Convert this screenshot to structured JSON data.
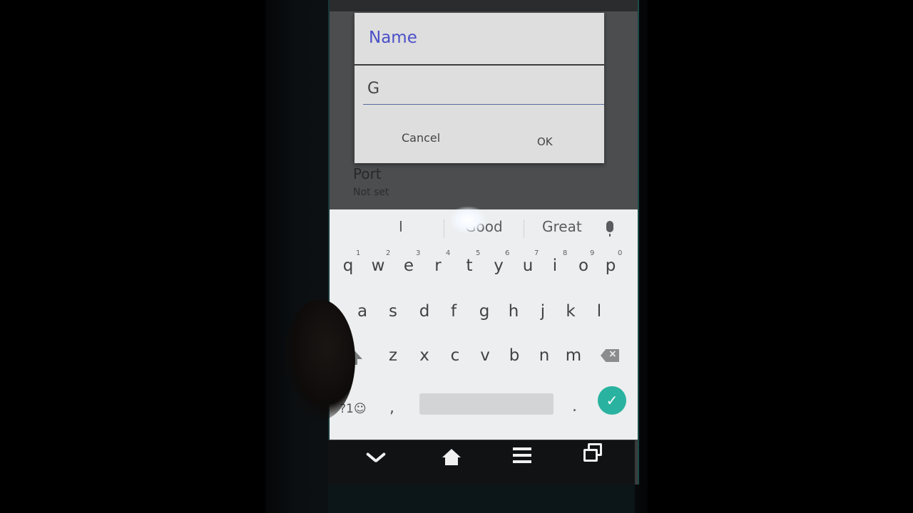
{
  "dialog": {
    "title": "Name",
    "input_value": "G",
    "cancel_label": "Cancel",
    "ok_label": "OK"
  },
  "background_setting": {
    "label": "Port",
    "value": "Not set"
  },
  "keyboard": {
    "suggestions": [
      "I",
      "Good",
      "Great"
    ],
    "row1": [
      {
        "key": "q",
        "num": "1"
      },
      {
        "key": "w",
        "num": "2"
      },
      {
        "key": "e",
        "num": "3"
      },
      {
        "key": "r",
        "num": "4"
      },
      {
        "key": "t",
        "num": "5"
      },
      {
        "key": "y",
        "num": "6"
      },
      {
        "key": "u",
        "num": "7"
      },
      {
        "key": "i",
        "num": "8"
      },
      {
        "key": "o",
        "num": "9"
      },
      {
        "key": "p",
        "num": "0"
      }
    ],
    "row2": [
      "a",
      "s",
      "d",
      "f",
      "g",
      "h",
      "j",
      "k",
      "l"
    ],
    "row3": [
      "z",
      "x",
      "c",
      "v",
      "b",
      "n",
      "m"
    ],
    "symbols_label": "?1☺",
    "comma": ",",
    "period": ".",
    "enter_glyph": "✓",
    "accent_color": "#2ab2a0"
  },
  "icons": {
    "mic": "mic-icon",
    "shift": "shift-icon",
    "backspace": "backspace-icon",
    "nav_back": "chevron-down-icon",
    "nav_home": "home-icon",
    "nav_menu": "menu-icon",
    "nav_recent": "recent-apps-icon"
  }
}
